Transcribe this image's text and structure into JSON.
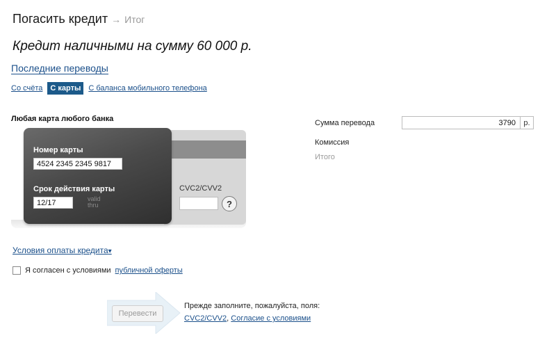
{
  "header": {
    "title": "Погасить кредит",
    "arrow": "→",
    "next_step": "Итог"
  },
  "subtitle": "Кредит наличными на сумму 60 000 р.",
  "recent_transfers": "Последние переводы",
  "tabs": [
    {
      "label": "Со счёта",
      "active": false
    },
    {
      "label": "С карты",
      "active": true
    },
    {
      "label": "С баланса мобильного телефона",
      "active": false
    }
  ],
  "card": {
    "heading": "Любая карта любого банка",
    "number_label": "Номер карты",
    "number_value": "4524 2345 2345 9817",
    "expiry_label": "Срок действия карты",
    "expiry_value": "12/17",
    "valid_thru_1": "valid",
    "valid_thru_2": "thru",
    "cvc_label": "CVC2/CVV2",
    "cvc_value": "",
    "help": "?"
  },
  "terms_link": "Условия оплаты кредита",
  "terms_caret": "▾",
  "agree": {
    "text": "Я согласен с условиями",
    "link": "публичной оферты",
    "checked": false
  },
  "submit": {
    "label": "Перевести",
    "hint": "Прежде заполните, пожалуйста, поля:",
    "field1": "CVC2/CVV2",
    "separator": ",",
    "field2": "Согласие с условиями"
  },
  "summary": {
    "amount_label": "Сумма перевода",
    "amount_value": "3790",
    "currency": "р.",
    "commission_label": "Комиссия",
    "total_label": "Итого"
  },
  "colors": {
    "link": "#1a4f8a",
    "active_tab": "#1c5a8a",
    "card_dark": "#4a4a4a",
    "muted": "#9a9a9a"
  }
}
